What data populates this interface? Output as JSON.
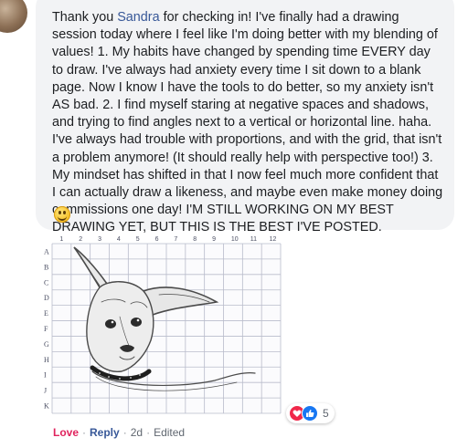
{
  "comment": {
    "author": "Sandra",
    "text_before_author": "Thank you ",
    "text_after_author": " for checking in! I've finally had a drawing session today where I feel like I'm doing better with my blending of values! 1. My habits have changed by spending time EVERY day to draw. I've always had anxiety every time I sit down to a blank page. Now I know I have the tools to do better, so my anxiety isn't AS bad. 2. I find myself staring at negative spaces and shadows, and trying to find angles next to a vertical or horizontal line. haha. I've always had trouble with proportions, and with the grid, that isn't a problem anymore! (It should really help with perspective too!) 3. My mindset has shifted in that I now feel much more confident that I can actually draw a likeness, and maybe even make money doing commissions one day! I'M STILL WORKING ON MY BEST DRAWING YET, BUT THIS IS THE BEST I'VE POSTED.",
    "emoji": "smiley-emoji"
  },
  "photo": {
    "grid_columns": [
      "1",
      "2",
      "3",
      "4",
      "5",
      "6",
      "7",
      "8",
      "9",
      "10",
      "11",
      "12"
    ],
    "grid_rows": [
      "A",
      "B",
      "C",
      "D",
      "E",
      "F",
      "G",
      "H",
      "I",
      "J",
      "K"
    ]
  },
  "reactions": {
    "types": [
      "love-icon",
      "like-icon"
    ],
    "count": "5"
  },
  "actions": {
    "love": "Love",
    "reply": "Reply",
    "separator": "·",
    "time": "2d",
    "edited": "Edited"
  },
  "colors": {
    "bubble": "#f2f3f5",
    "author_link": "#385898",
    "love": "#e0245e",
    "like": "#1877f2"
  }
}
